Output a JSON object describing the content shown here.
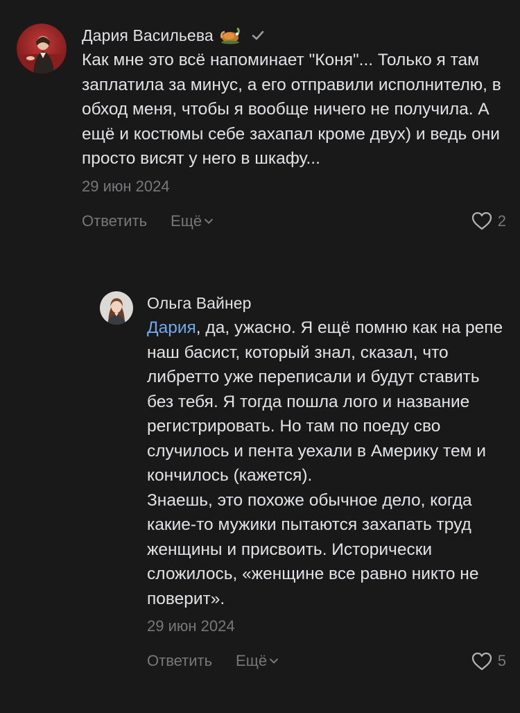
{
  "comments": [
    {
      "author": "Дария Васильева",
      "badge_icon": "turkey-emoji-icon",
      "verified_icon": "checkmark-icon",
      "text": "Как мне это всё напоминает \"Коня\"... Только я там заплатила за минус, а его отправили исполнителю, в обход меня, чтобы я вообще ничего не получила. А ещё и костюмы себе захапал кроме двух) и ведь они просто висят у него в шкафу...",
      "date": "29 июн 2024",
      "reply_label": "Ответить",
      "more_label": "Ещё",
      "likes": "2"
    },
    {
      "author": "Ольга Вайнер",
      "mention": "Дария",
      "text": ", да, ужасно. Я ещё помню как на репе наш басист, который знал, сказал, что либретто уже переписали и будут ставить без тебя. Я тогда пошла лого и название регистрировать. Но там по поеду сво случилось и пента уехали в Америку тем и кончилось (кажется).\nЗнаешь, это похоже обычное дело, когда какие-то мужики пытаются захапать труд женщины и присвоить. Исторически сложилось, «женщине все равно никто не поверит».",
      "date": "29 июн 2024",
      "reply_label": "Ответить",
      "more_label": "Ещё",
      "likes": "5"
    }
  ],
  "colors": {
    "background": "#191919",
    "text": "#e1e3e6",
    "secondary": "#76787a",
    "mention": "#71aaeb"
  }
}
